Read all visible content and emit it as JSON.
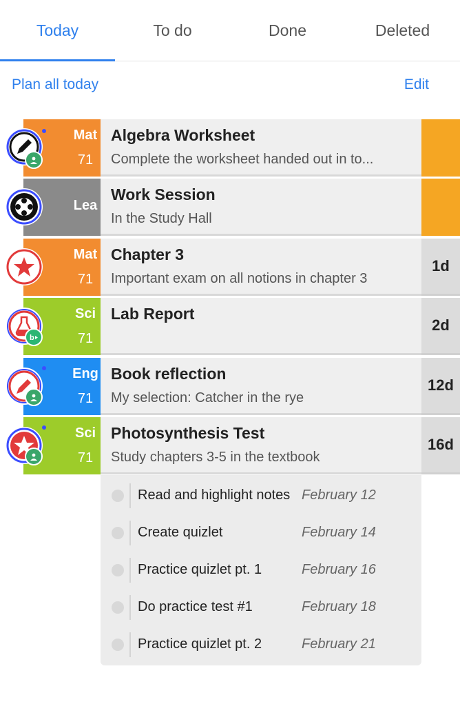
{
  "tabs": [
    {
      "label": "Today",
      "active": true
    },
    {
      "label": "To do",
      "active": false
    },
    {
      "label": "Done",
      "active": false
    },
    {
      "label": "Deleted",
      "active": false
    }
  ],
  "actions": {
    "plan_all": "Plan all today",
    "edit": "Edit"
  },
  "colors": {
    "accent": "#2f80ed",
    "math": "#f28c30",
    "lea": "#8a8a8a",
    "science": "#9dcc2a",
    "english": "#1f8df2",
    "due_highlight": "#f5a623",
    "google_green": "#3aa66a"
  },
  "tasks": [
    {
      "code": "Mat",
      "number": "71",
      "icon": "pencil-icon",
      "service_icon": "google-classroom-icon",
      "title": "Algebra Worksheet",
      "subtitle": "Complete the worksheet handed out in to...",
      "due": ""
    },
    {
      "code": "Lea",
      "number": "",
      "icon": "film-reel-icon",
      "service_icon": "",
      "title": "Work Session",
      "subtitle": "In the Study Hall",
      "due": ""
    },
    {
      "code": "Mat",
      "number": "71",
      "icon": "star-icon",
      "service_icon": "",
      "title": "Chapter 3",
      "subtitle": "Important exam on all notions in chapter 3",
      "due": "1d"
    },
    {
      "code": "Sci",
      "number": "71",
      "icon": "flask-icon",
      "service_icon": "play-icon",
      "title": "Lab Report",
      "subtitle": "",
      "due": "2d"
    },
    {
      "code": "Eng",
      "number": "71",
      "icon": "pencil-icon",
      "service_icon": "google-classroom-icon",
      "title": "Book reflection",
      "subtitle": "My selection: Catcher in the rye",
      "due": "12d"
    },
    {
      "code": "Sci",
      "number": "71",
      "icon": "star-icon",
      "service_icon": "google-classroom-icon",
      "title": "Photosynthesis Test",
      "subtitle": "Study chapters 3-5 in the textbook",
      "due": "16d"
    }
  ],
  "subtasks": [
    {
      "name": "Read and highlight notes",
      "date": "February 12"
    },
    {
      "name": "Create quizlet",
      "date": "February 14"
    },
    {
      "name": "Practice quizlet pt. 1",
      "date": "February 16"
    },
    {
      "name": "Do practice test #1",
      "date": "February 18"
    },
    {
      "name": "Practice quizlet pt. 2",
      "date": "February 21"
    }
  ]
}
